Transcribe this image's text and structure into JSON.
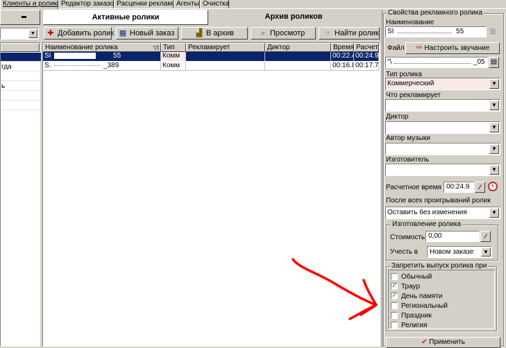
{
  "top_tabs": [
    {
      "label": "Клиенты и ролики"
    },
    {
      "label": "Редактор заказов"
    },
    {
      "label": "Расценки рекламы"
    },
    {
      "label": "Агенты"
    },
    {
      "label": "Очистка"
    }
  ],
  "left_panel": {
    "rows": [
      "",
      "гда",
      "",
      "ь",
      "",
      ""
    ]
  },
  "sub_tabs": {
    "active": "Активные ролики",
    "archive": "Архив роликов"
  },
  "toolbar": {
    "add": "Добавить ролик",
    "new_order": "Новый заказ",
    "to_archive": "В архив",
    "preview": "Просмотр",
    "find": "Найти ролик"
  },
  "grid": {
    "columns": [
      "Наименование ролика",
      "Тип",
      "Рекламирует",
      "Диктор",
      "Время",
      "Расчет."
    ],
    "rows": [
      {
        "name": "SI",
        "name_tail": "55",
        "type": "Комм",
        "advertises": "",
        "speaker": "",
        "time": "00:22.4",
        "calc": "00:24.9",
        "selected": true
      },
      {
        "name": "S.",
        "name_tail": "_389",
        "type": "Комм",
        "advertises": "",
        "speaker": "",
        "time": "00:16.8",
        "calc": "00:17.7",
        "selected": false
      }
    ]
  },
  "props": {
    "panel_title": "Свойства рекламного ролика",
    "name_label": "Наименование",
    "name_value": "SI",
    "name_value_tail": "55",
    "file_tab": "Файл",
    "tune_button": "Настроить звучание",
    "file_path": "\"\\",
    "file_path_tail": "_05",
    "type_label": "Тип ролика",
    "type_value": "Коммерческий",
    "advertises_label": "Что рекламирует",
    "advertises_value": "",
    "speaker_label": "Диктор",
    "speaker_value": "",
    "music_label": "Автор музыки",
    "music_value": "",
    "maker_label": "Изготовитель",
    "maker_value": "",
    "calc_time_label": "Расчетное время",
    "calc_time_value": "00:24.9",
    "after_label": "После всех проигрываний ролик",
    "after_value": "Оставить без изменения",
    "production_group": "Изготовление ролика",
    "cost_label": "Стоимость",
    "cost_value": "0,00",
    "account_label": "Учесть в",
    "account_value": "Новом заказе",
    "forbid_group": "Запретить выпуск ролика при",
    "checks": [
      {
        "label": "Обычный",
        "checked": false
      },
      {
        "label": "Траур",
        "checked": true
      },
      {
        "label": "День памяти",
        "checked": true
      },
      {
        "label": "Региональный",
        "checked": false
      },
      {
        "label": "Праздник",
        "checked": false
      },
      {
        "label": "Религия",
        "checked": false
      }
    ],
    "apply_button": "Применить"
  },
  "colors": {
    "selection": "#0a246a",
    "annotation": "#ff0000",
    "type_field_bg": "#f8e8e8",
    "check_mark": "#1a9a1a"
  }
}
